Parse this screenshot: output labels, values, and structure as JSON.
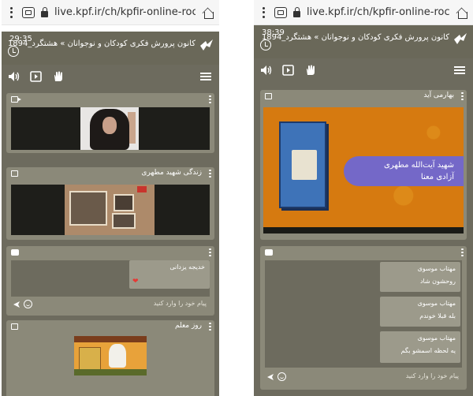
{
  "left": {
    "browser": {
      "url": "live.kpf.ir/ch/kpfir-online-roc"
    },
    "header": {
      "time": "29:35",
      "title": "کانون پرورش فکری کودکان و نوجوانان » هشتگرد_1894"
    },
    "cards": {
      "webcam": {
        "title": ""
      },
      "video": {
        "title": "زندگی شهید مطهری"
      },
      "chat": {
        "messages": [
          {
            "name": "خدیجه یزدانی",
            "text": ""
          }
        ],
        "placeholder": "پیام خود را وارد کنید"
      },
      "poster": {
        "title": "روز معلم"
      }
    }
  },
  "right": {
    "browser": {
      "url": "live.kpf.ir/ch/kpfir-online-roc"
    },
    "header": {
      "time": "38:39",
      "title": "کانون پرورش فکری کودکان و نوجوانان » هشتگرد_1894"
    },
    "cards": {
      "slide": {
        "title": "بهارمی آید",
        "line1": "شهید آیت‌الله مطهری",
        "line2": "آزادی معنا"
      },
      "chat": {
        "messages": [
          {
            "name": "مهتاب موسوی",
            "text": "روحشون شاد"
          },
          {
            "name": "مهتاب موسوی",
            "text": "بله قبلا خوندم"
          },
          {
            "name": "مهتاب موسوی",
            "text": "یه لحظه اسمشو بگم"
          }
        ],
        "placeholder": "پیام خود را وارد کنید"
      }
    }
  },
  "colors": {
    "app_bg": "#6d6b5e",
    "card_bg": "#8b8979",
    "bubble_bg": "#9c9a8b",
    "accent": "#37b6ff",
    "heart": "#e53935"
  },
  "icons": [
    "kebab-icon",
    "tabs-icon",
    "lock-icon",
    "home-icon",
    "clock-icon",
    "kanoon-logo-icon",
    "speaker-icon",
    "video-icon",
    "hand-icon",
    "hamburger-icon",
    "camera-icon",
    "chat-icon",
    "send-icon",
    "emoji-icon",
    "heart-icon"
  ]
}
